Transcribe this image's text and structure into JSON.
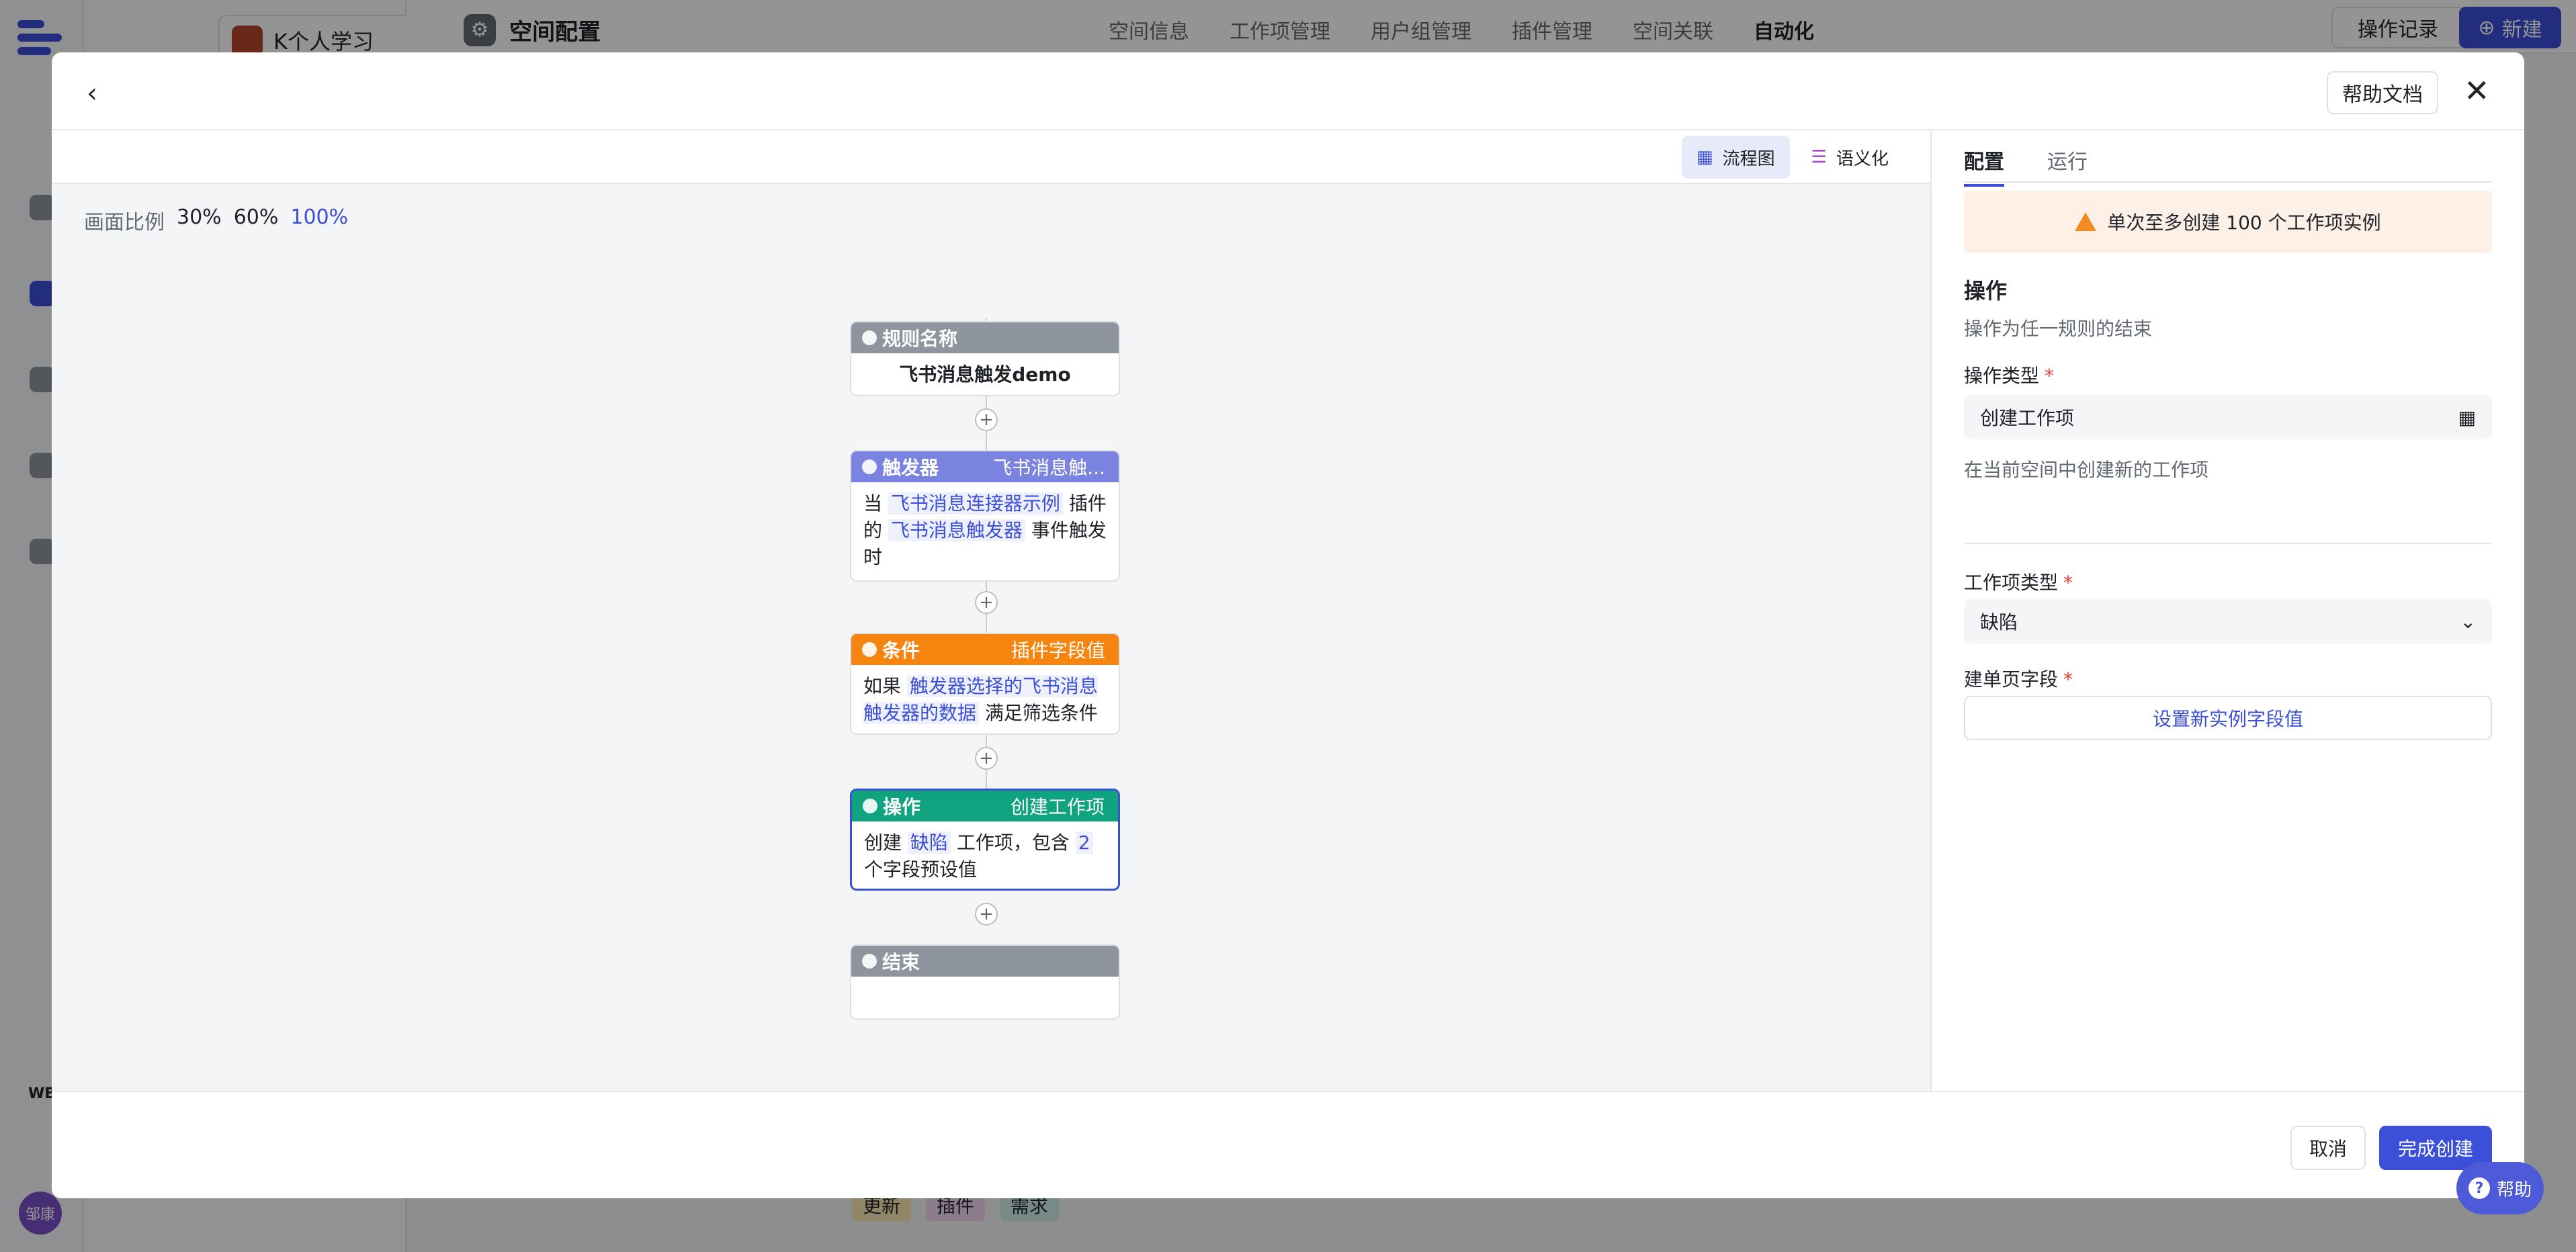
{
  "background": {
    "workspace_name": "K个人学习",
    "page_title": "空间配置",
    "top_tabs": [
      "空间信息",
      "工作项管理",
      "用户组管理",
      "插件管理",
      "空间关联",
      "自动化"
    ],
    "log_button": "操作记录",
    "new_button": "新建",
    "tags": [
      "更新",
      "插件",
      "需求"
    ],
    "user_avatar": "邹康",
    "sidebar_badge": "WB"
  },
  "modal": {
    "help_doc": "帮助文档",
    "view_modes": [
      "流程图",
      "语义化"
    ],
    "zoom_label": "画面比例",
    "zoom_options": [
      "30%",
      "60%",
      "100%"
    ],
    "zoom_current": "100%",
    "nodes": {
      "rule": {
        "title": "规则名称",
        "body": "飞书消息触发demo"
      },
      "trigger": {
        "title": "触发器",
        "right": "飞书消息触...",
        "t1": "当",
        "h1": "飞书消息连接器示例",
        "t2": "插件的",
        "h2": "飞书消息触发器",
        "t3": "事件触发时"
      },
      "condition": {
        "title": "条件",
        "right": "插件字段值",
        "t1": "如果",
        "h1": "触发器选择的飞书消息触发器的数据",
        "t2": "满足筛选条件"
      },
      "action": {
        "title": "操作",
        "right": "创建工作项",
        "t1": "创建",
        "h1": "缺陷",
        "t2": "工作项，包含",
        "h2": "2",
        "t3": "个字段预设值"
      },
      "end": {
        "title": "结束"
      }
    },
    "panel": {
      "tabs": [
        "配置",
        "运行"
      ],
      "warning": "单次至多创建 100 个工作项实例",
      "section_title": "操作",
      "section_hint": "操作为任一规则的结束",
      "op_type_label": "操作类型",
      "op_type_value": "创建工作项",
      "op_type_hint": "在当前空间中创建新的工作项",
      "item_type_label": "工作项类型",
      "item_type_value": "缺陷",
      "form_field_label": "建单页字段",
      "form_field_button": "设置新实例字段值"
    },
    "footer": {
      "cancel": "取消",
      "finish": "完成创建"
    }
  },
  "help_fab": "帮助",
  "colors": {
    "accent": "#3c4fd9",
    "trigger": "#7b83e0",
    "condition": "#f5850f",
    "action": "#10a37f",
    "neutral": "#8f959e"
  }
}
